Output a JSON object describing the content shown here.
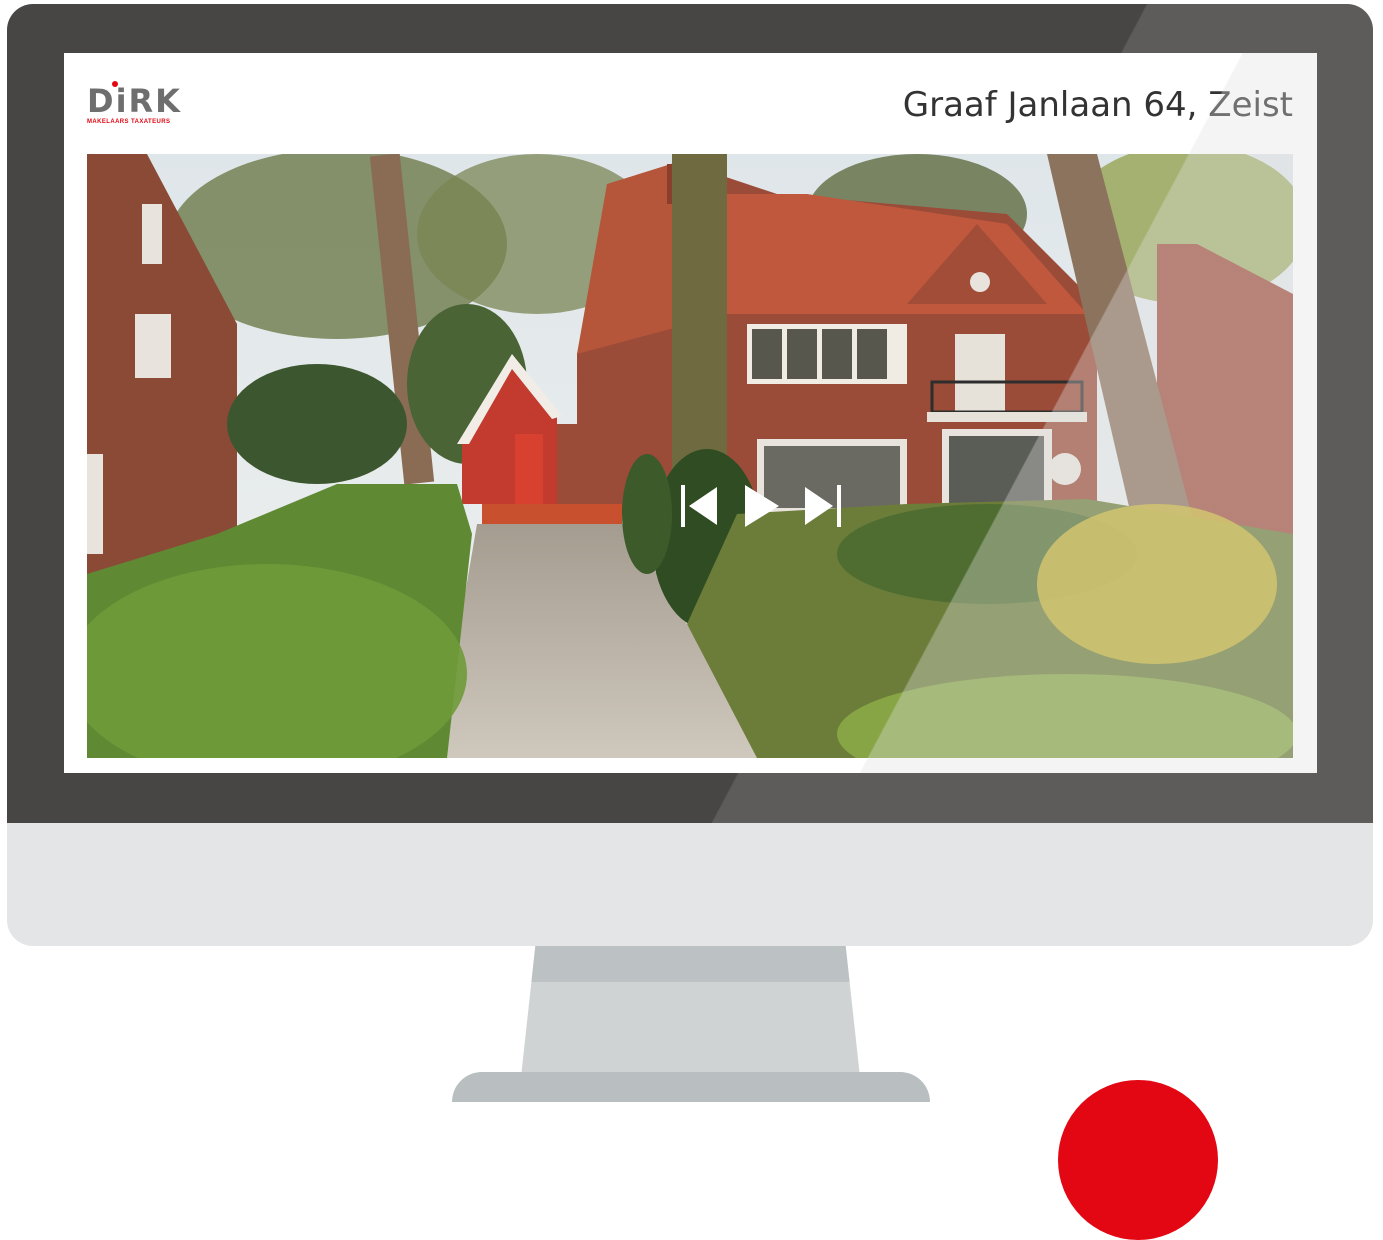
{
  "brand": {
    "logo_text": "DiRK",
    "logo_tagline": "MAKELAARS TAXATEURS",
    "accent_color": "#e30613"
  },
  "listing": {
    "address": "Graaf Janlaan 64, Zeist"
  },
  "media_controls": {
    "previous_icon": "skip-back-icon",
    "play_icon": "play-icon",
    "next_icon": "skip-forward-icon"
  },
  "colors": {
    "bezel": "#474644",
    "chin": "#e4e5e7",
    "stand": "#cfd3d4"
  }
}
